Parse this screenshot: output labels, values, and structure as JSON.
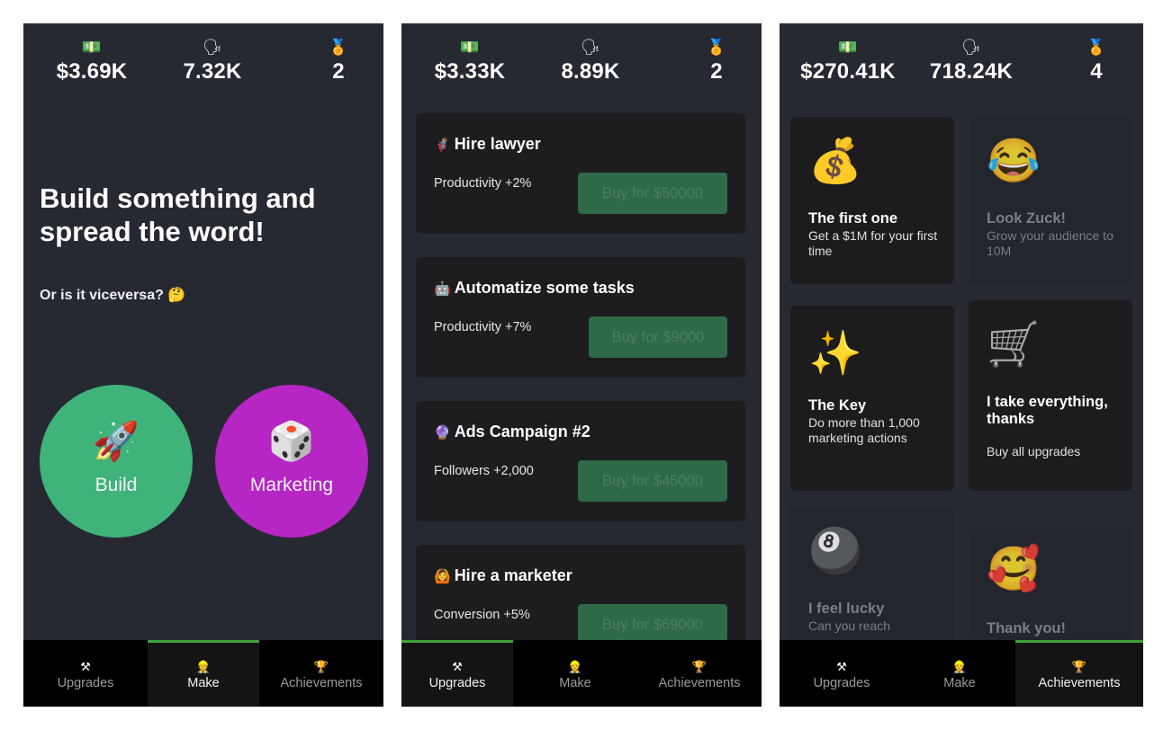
{
  "colors": {
    "background": "#262932",
    "card": "#1d1d1f",
    "build": "#3fb37a",
    "marketing": "#b526c4",
    "buy_button": "#2e6a48",
    "active_tab_indicator": "#3ea23a"
  },
  "tabs": [
    {
      "icon": "tools-icon",
      "glyph": "⚒",
      "label": "Upgrades"
    },
    {
      "icon": "person-icon",
      "glyph": "👷",
      "label": "Make"
    },
    {
      "icon": "trophy-icon",
      "glyph": "🏆",
      "label": "Achievements"
    }
  ],
  "stat_icons": {
    "money": "💵",
    "followers": "🗣",
    "medal": "🏅"
  },
  "screens": [
    {
      "name": "make",
      "active_tab": "Make",
      "stats": {
        "money": "$3.69K",
        "followers": "7.32K",
        "achievements": "2"
      },
      "title": "Build something and spread the word!",
      "subtitle": "Or is it viceversa? 🤔",
      "buttons": [
        {
          "emoji": "🚀",
          "label": "Build"
        },
        {
          "emoji": "🎲",
          "label": "Marketing"
        }
      ]
    },
    {
      "name": "upgrades",
      "active_tab": "Upgrades",
      "stats": {
        "money": "$3.33K",
        "followers": "8.89K",
        "achievements": "2"
      },
      "upgrades": [
        {
          "emoji": "🦸",
          "title": "Hire lawyer",
          "effect": "Productivity +2%",
          "buy_label": "Buy for $50000"
        },
        {
          "emoji": "🤖",
          "title": "Automatize some tasks",
          "effect": "Productivity +7%",
          "buy_label": "Buy for $9000"
        },
        {
          "emoji": "🔮",
          "title": "Ads Campaign #2",
          "effect": "Followers +2,000",
          "buy_label": "Buy for $45000"
        },
        {
          "emoji": "🙆",
          "title": "Hire a marketer",
          "effect": "Conversion +5%",
          "buy_label": "Buy for $69000"
        }
      ]
    },
    {
      "name": "achievements",
      "active_tab": "Achievements",
      "stats": {
        "money": "$270.41K",
        "followers": "718.24K",
        "achievements": "4"
      },
      "achievements": [
        {
          "emoji": "💰",
          "title": "The first one",
          "desc": "Get a $1M for your first time",
          "unlocked": true
        },
        {
          "emoji": "😂",
          "title": "Look Zuck!",
          "desc": "Grow your audience to 10M",
          "unlocked": false
        },
        {
          "emoji": "✨",
          "title": "The Key",
          "desc": "Do more than 1,000 marketing actions",
          "unlocked": true
        },
        {
          "emoji": "🛒",
          "title": "I take everything, thanks",
          "desc": "Buy all upgrades",
          "unlocked": true
        },
        {
          "emoji": "🎱",
          "title": "I feel lucky",
          "desc": "Can you reach",
          "unlocked": false
        },
        {
          "emoji": "🥰",
          "title": "Thank you!",
          "desc": "",
          "unlocked": false
        }
      ]
    }
  ]
}
